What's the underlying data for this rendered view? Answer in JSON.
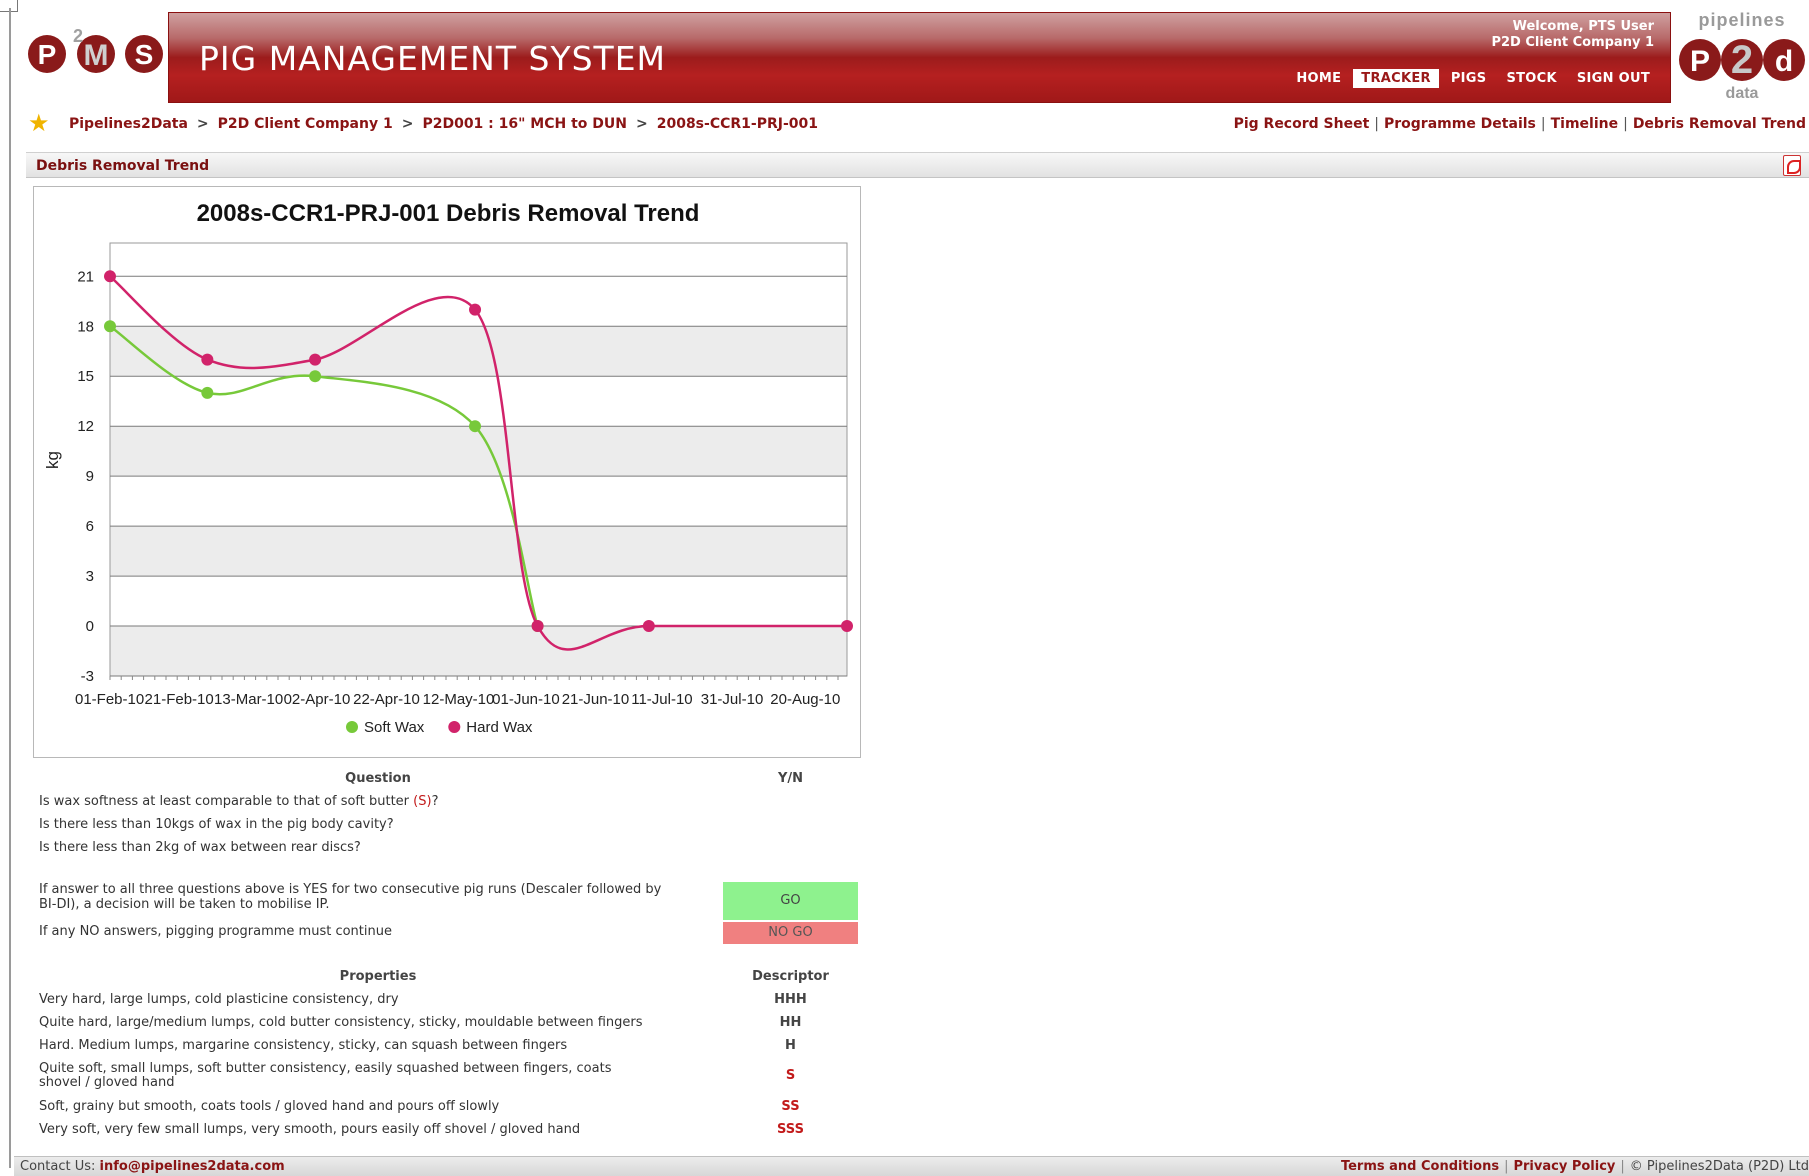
{
  "header": {
    "logo_letters": [
      "P",
      "M",
      "S"
    ],
    "logo_sup": "2",
    "app_title": "PIG MANAGEMENT SYSTEM",
    "welcome_line1": "Welcome, PTS User",
    "welcome_line2": "P2D Client Company 1",
    "nav": [
      "HOME",
      "TRACKER",
      "PIGS",
      "STOCK",
      "SIGN OUT"
    ],
    "nav_active": "TRACKER",
    "partner_logo_top": "pipelines",
    "partner_logo_bottom": "data",
    "partner_letters": [
      "P",
      "2",
      "d"
    ]
  },
  "breadcrumb": [
    "Pipelines2Data",
    "P2D Client Company 1",
    "P2D001 : 16\" MCH to DUN",
    "2008s-CCR1-PRJ-001"
  ],
  "breadcrumb_sep": ">",
  "page_links": [
    "Pig Record Sheet",
    "Programme Details",
    "Timeline",
    "Debris Removal Trend"
  ],
  "section_title": "Debris Removal Trend",
  "chart_data": {
    "type": "line",
    "title": "2008s-CCR1-PRJ-001 Debris Removal Trend",
    "ylabel": "kg",
    "xlabel": "",
    "ylim": [
      -3,
      23
    ],
    "yticks": [
      -3,
      0,
      3,
      6,
      9,
      12,
      15,
      18,
      21
    ],
    "x_ticks": [
      "01-Feb-10",
      "21-Feb-10",
      "13-Mar-10",
      "02-Apr-10",
      "22-Apr-10",
      "12-May-10",
      "01-Jun-10",
      "21-Jun-10",
      "11-Jul-10",
      "31-Jul-10",
      "20-Aug-10"
    ],
    "x_range": [
      "2010-02-01",
      "2010-09-01"
    ],
    "legend_position": "bottom",
    "grid": true,
    "series": [
      {
        "name": "Soft Wax",
        "color": "#77c93a",
        "points": [
          [
            "2010-02-01",
            18
          ],
          [
            "2010-03-01",
            14
          ],
          [
            "2010-04-01",
            15
          ],
          [
            "2010-05-17",
            12
          ],
          [
            "2010-06-04",
            0
          ]
        ]
      },
      {
        "name": "Hard Wax",
        "color": "#d1236a",
        "points": [
          [
            "2010-02-01",
            21
          ],
          [
            "2010-03-01",
            16
          ],
          [
            "2010-04-01",
            16
          ],
          [
            "2010-05-17",
            19
          ],
          [
            "2010-06-04",
            0
          ],
          [
            "2010-07-06",
            0
          ],
          [
            "2010-09-01",
            0
          ]
        ]
      }
    ]
  },
  "questions": {
    "header_question": "Question",
    "header_yn": "Y/N",
    "q1_text": "Is wax softness at least comparable to that of soft butter ",
    "q1_code": "(S)",
    "q1_end": "?",
    "q2": "Is there less than 10kgs of wax in the pig body cavity?",
    "q3": "Is there less than 2kg of wax between rear discs?",
    "rule_go_line1": "If answer to all three questions above is YES for two consecutive pig runs (Descaler followed by",
    "rule_go_line2": "BI-DI), a decision will be taken to mobilise IP.",
    "go_label": "GO",
    "rule_nogo": "If any NO answers, pigging programme must continue",
    "nogo_label": "NO GO",
    "go_color": "#8ef28e",
    "nogo_color": "#f08080"
  },
  "properties": {
    "header_props": "Properties",
    "header_desc": "Descriptor",
    "rows": [
      {
        "text": "Very hard, large lumps, cold plasticine consistency, dry",
        "code": "HHH"
      },
      {
        "text": "Quite hard, large/medium lumps, cold butter consistency, sticky, mouldable between fingers",
        "code": "HH"
      },
      {
        "text": "Hard. Medium lumps, margarine consistency, sticky, can squash between fingers",
        "code": "H"
      },
      {
        "text": "Quite soft, small lumps, soft butter consistency, easily squashed between fingers, coats",
        "text2": "shovel / gloved hand",
        "code": "S"
      },
      {
        "text": "Soft, grainy but smooth, coats tools / gloved hand and pours off slowly",
        "code": "SS"
      },
      {
        "text": "Very soft, very few small lumps, very smooth, pours easily off shovel / gloved hand",
        "code": "SSS"
      }
    ]
  },
  "footer": {
    "contact_label": "Contact Us:",
    "contact_email": "info@pipelines2data.com",
    "terms": "Terms and Conditions",
    "privacy": "Privacy Policy",
    "copyright": "© Pipelines2Data (P2D) Ltd"
  },
  "colors": {
    "brand_red": "#9c1c1c",
    "link_red": "#8a1414",
    "soft_wax": "#77c93a",
    "hard_wax": "#d1236a"
  }
}
